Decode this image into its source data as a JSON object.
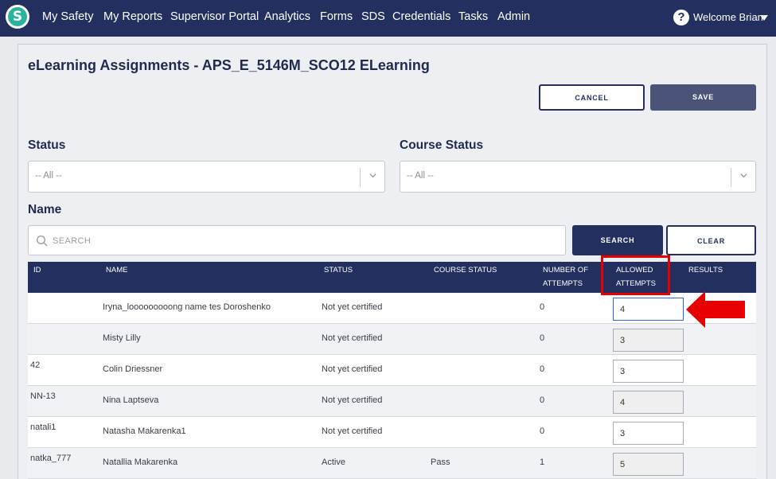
{
  "nav": {
    "logo_letter": "S",
    "items": [
      "My Safety",
      "My Reports",
      "Supervisor Portal",
      "Analytics",
      "Forms",
      "SDS",
      "Credentials",
      "Tasks",
      "Admin"
    ],
    "help_glyph": "?",
    "welcome": "Welcome Brian"
  },
  "page": {
    "title": "eLearning Assignments - APS_E_5146M_SCO12 ELearning",
    "cancel_label": "CANCEL",
    "save_label": "SAVE"
  },
  "filters": {
    "status_label": "Status",
    "status_value": "-- All --",
    "course_status_label": "Course Status",
    "course_status_value": "-- All --",
    "name_label": "Name",
    "search_placeholder": "SEARCH",
    "search_button": "SEARCH",
    "clear_button": "CLEAR"
  },
  "table": {
    "headers": {
      "id": "ID",
      "name": "NAME",
      "status": "STATUS",
      "course_status": "COURSE STATUS",
      "attempts_line1": "NUMBER OF",
      "attempts_line2": "ATTEMPTS",
      "allowed_line1": "ALLOWED",
      "allowed_line2": "ATTEMPTS",
      "results": "RESULTS"
    },
    "rows": [
      {
        "id": "",
        "name": "Iryna_looooooooong name tes Doroshenko",
        "status": "Not yet certified",
        "course_status": "",
        "attempts": "0",
        "allowed": "4"
      },
      {
        "id": "",
        "name": "Misty Lilly",
        "status": "Not yet certified",
        "course_status": "",
        "attempts": "0",
        "allowed": "3"
      },
      {
        "id": "42",
        "name": "Colin Driessner",
        "status": "Not yet certified",
        "course_status": "",
        "attempts": "0",
        "allowed": "3"
      },
      {
        "id": "NN-13",
        "name": "Nina Laptseva",
        "status": "Not yet certified",
        "course_status": "",
        "attempts": "0",
        "allowed": "4"
      },
      {
        "id": "natali1",
        "name": "Natasha Makarenka1",
        "status": "Not yet certified",
        "course_status": "",
        "attempts": "0",
        "allowed": "3"
      },
      {
        "id": "natka_777",
        "name": "Natallia Makarenka",
        "status": "Active",
        "course_status": "Pass",
        "attempts": "1",
        "allowed": "5"
      }
    ]
  },
  "colors": {
    "navy": "#232f5e",
    "highlight_red": "#e60000",
    "logo_teal": "#2bb3a0"
  }
}
